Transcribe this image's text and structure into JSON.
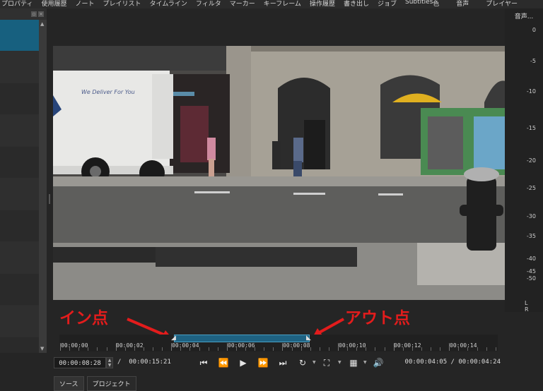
{
  "menu": {
    "items": [
      "プロパティ",
      "使用履歴",
      "ノート",
      "プレイリスト",
      "タイムライン",
      "フィルタ",
      "マーカー",
      "キーフレーム",
      "操作履歴",
      "書き出し",
      "ジョブ",
      "Subtitles"
    ],
    "right_items": [
      "色",
      "音声",
      "プレイヤー"
    ]
  },
  "meters": {
    "title": "音声...",
    "ticks": [
      "0",
      "-5",
      "-10",
      "-15",
      "-20",
      "-25",
      "-30",
      "-35",
      "-40",
      "-45",
      "-50"
    ],
    "lr": "L R"
  },
  "timeline": {
    "labels": [
      "00:00:00",
      "00:00:02",
      "00:00:04",
      "00:00:06",
      "00:00:08",
      "00:00:10",
      "00:00:12",
      "00:00:14"
    ]
  },
  "controls": {
    "position": "00:00:08:28",
    "separator": "/",
    "duration": "00:00:15:21",
    "in_out_info": "00:00:04:05  /  00:00:04:24"
  },
  "annotations": {
    "in_point": "イン点",
    "out_point": "アウト点"
  },
  "tabs": [
    "ソース",
    "プロジェクト"
  ],
  "colors": {
    "accent": "#17607f",
    "annotation": "#e31c1c",
    "background": "#252525"
  }
}
